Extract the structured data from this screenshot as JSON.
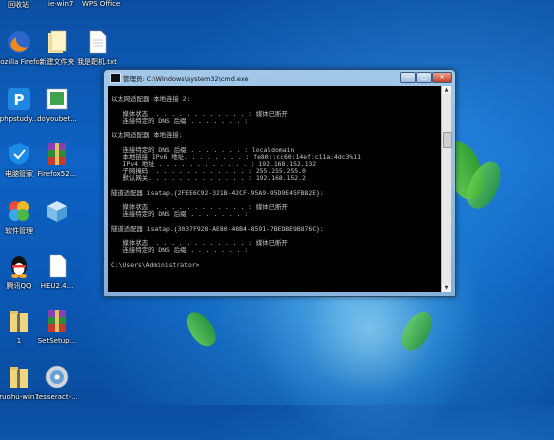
{
  "desktop": {
    "top_labels": [
      "回收站",
      "ie-win7",
      "WPS Office"
    ],
    "icons": [
      {
        "label": "Mozilla Firefox",
        "icon": "firefox-icon"
      },
      {
        "label": "新建文件夹",
        "icon": "folder-icon"
      },
      {
        "label": "我是靶机.txt",
        "icon": "text-file-icon"
      },
      {
        "label": "phpstudy...",
        "icon": "phpstudy-icon"
      },
      {
        "label": "doyoubet...",
        "icon": "image-file-icon"
      },
      {
        "label": "电脑管家",
        "icon": "pc-manager-icon"
      },
      {
        "label": "Firefox52...",
        "icon": "winrar-archive-icon"
      },
      {
        "label": "软件管理",
        "icon": "software-manager-icon"
      },
      {
        "label": "",
        "icon": "3d-box-icon"
      },
      {
        "label": "腾讯QQ",
        "icon": "qq-icon"
      },
      {
        "label": "HEU2.4...",
        "icon": "document-icon"
      },
      {
        "label": "1",
        "icon": "zip-folder-icon"
      },
      {
        "label": "SetSetup...",
        "icon": "winrar-archive-icon"
      },
      {
        "label": "ruohu-win7",
        "icon": "zip-folder-icon"
      },
      {
        "label": "tesseract-...",
        "icon": "disc-installer-icon"
      }
    ]
  },
  "window": {
    "title": "管理员: C:\\Windows\\system32\\cmd.exe",
    "minimize": "—",
    "maximize": "□",
    "close": "✕"
  },
  "console": {
    "lines": [
      "",
      "以太网适配器 本地连接 2:",
      "",
      "   媒体状态  . . . . . . . . . . . . : 媒体已断开",
      "   连接特定的 DNS 后缀 . . . . . . . :",
      "",
      "以太网适配器 本地连接:",
      "",
      "   连接特定的 DNS 后缀 . . . . . . . : localdomain",
      "   本地链接 IPv6 地址. . . . . . . . : fe80::cc60:14ef:c11a:4dc3%11",
      "   IPv4 地址 . . . . . . . . . . . . : 192.168.152.132",
      "   子网掩码  . . . . . . . . . . . . : 255.255.255.0",
      "   默认网关. . . . . . . . . . . . . : 192.168.152.2",
      "",
      "隧道适配器 isatap.{2FEE6C92-321B-42CF-95A9-95D9E45FB82E}:",
      "",
      "   媒体状态  . . . . . . . . . . . . : 媒体已断开",
      "   连接特定的 DNS 后缀 . . . . . . . :",
      "",
      "隧道适配器 isatap.{3037F928-AE80-48B4-8591-7BEDBE9B876C}:",
      "",
      "   媒体状态  . . . . . . . . . . . . : 媒体已断开",
      "   连接特定的 DNS 后缀 . . . . . . . :",
      "",
      "C:\\Users\\Administrator>"
    ]
  },
  "colors": {
    "console_text": "#c8c8c8",
    "console_bg": "#000000"
  }
}
